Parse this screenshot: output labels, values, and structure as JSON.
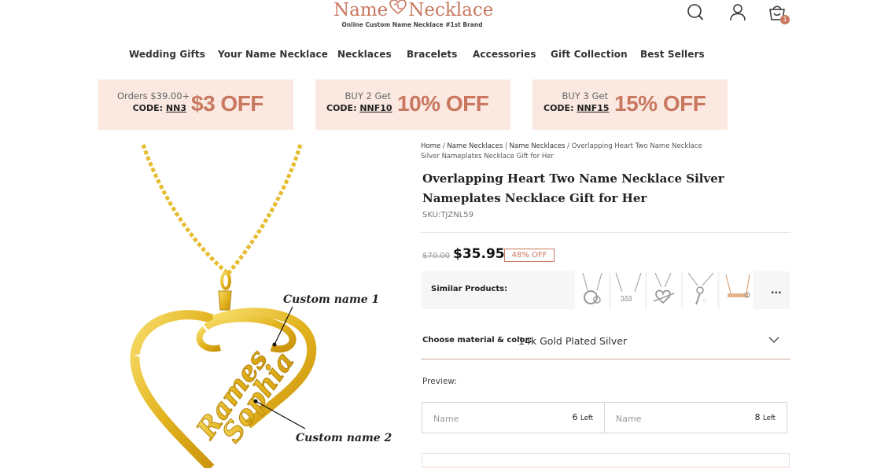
{
  "brand": {
    "name_left": "Name",
    "name_right": "Necklace",
    "tagline": "Online Custom Name Necklace #1st Brand",
    "accent_color": "#c9785f",
    "promo_bg": "#fae8e1"
  },
  "header_icons": {
    "search": "search-icon",
    "account": "user-icon",
    "cart": "cart-icon",
    "cart_count": "1"
  },
  "nav": [
    "Wedding Gifts",
    "Your Name Necklace",
    "Necklaces",
    "Bracelets",
    "Accessories",
    "Gift Collection",
    "Best Sellers"
  ],
  "promos": [
    {
      "line1": "Orders $39.00+",
      "code_label": "CODE:",
      "code": "NN3",
      "offer": "$3 OFF"
    },
    {
      "line1": "BUY 2 Get",
      "code_label": "CODE:",
      "code": "NNF10",
      "offer": "10% OFF"
    },
    {
      "line1": "BUY 3 Get",
      "code_label": "CODE:",
      "code": "NNF15",
      "offer": "15% OFF"
    }
  ],
  "image": {
    "label1": "Custom name 1",
    "label2": "Custom name 2",
    "engraved_top": "Rames",
    "engraved_bottom": "Sophia"
  },
  "breadcrumb": {
    "home": "Home",
    "sep": "/",
    "cat1": "Name Necklaces",
    "pipe": "|",
    "cat2": "Name Necklaces",
    "current": "Overlapping Heart Two Name Necklace Silver Nameplates Necklace Gift for Her"
  },
  "product": {
    "title": "Overlapping Heart Two Name Necklace Silver Nameplates Necklace Gift for Her",
    "sku": "SKU:TJZNL59",
    "old_price": "$70.00",
    "price": "$35.95",
    "discount": "48% OFF"
  },
  "similar": {
    "label": "Similar Products:",
    "more": "...",
    "thumbs": [
      "silver-circle-necklace",
      "silver-name-necklace",
      "silver-heart-necklace",
      "silver-key-necklace",
      "rose-gold-bar-necklace"
    ]
  },
  "options": {
    "choose_label": "Choose material & color:",
    "choose_value": "14k Gold Plated Silver",
    "preview_label": "Preview:",
    "name_fields": [
      {
        "placeholder": "Name",
        "count": "6",
        "unit": "Left"
      },
      {
        "placeholder": "Name",
        "count": "8",
        "unit": "Left"
      }
    ]
  }
}
